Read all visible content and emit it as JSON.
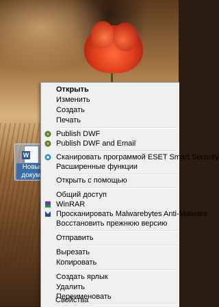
{
  "desktop": {
    "file_icon_name": [
      "Новый",
      "докуме"
    ],
    "file_icon_badge": "W"
  },
  "context_menu": {
    "items": [
      {
        "label": "Открыть",
        "bold": true
      },
      {
        "label": "Изменить"
      },
      {
        "label": "Создать"
      },
      {
        "label": "Печать"
      },
      {
        "label": "Publish DWF"
      },
      {
        "label": "Publish DWF and Email"
      },
      {
        "label": "Сканировать программой ESET Smart Security"
      },
      {
        "label": "Расширенные функции"
      },
      {
        "label": "Открыть с помощью"
      },
      {
        "label": "Общий доступ"
      },
      {
        "label": "WinRAR"
      },
      {
        "label": "Просканировать Malwarebytes Anti-Malware"
      },
      {
        "label": "Восстановить прежнюю версию"
      },
      {
        "label": "Отправить"
      },
      {
        "label": "Вырезать"
      },
      {
        "label": "Копировать"
      },
      {
        "label": "Создать ярлык"
      },
      {
        "label": "Удалить"
      },
      {
        "label": "Переименовать"
      },
      {
        "label": "Свойства"
      }
    ],
    "icons": {
      "publish_dwf": "dwf-icon",
      "publish_dwf_email": "dwf-email-icon",
      "eset": "eset-icon",
      "winrar": "winrar-icon",
      "malwarebytes": "malwarebytes-icon"
    }
  }
}
